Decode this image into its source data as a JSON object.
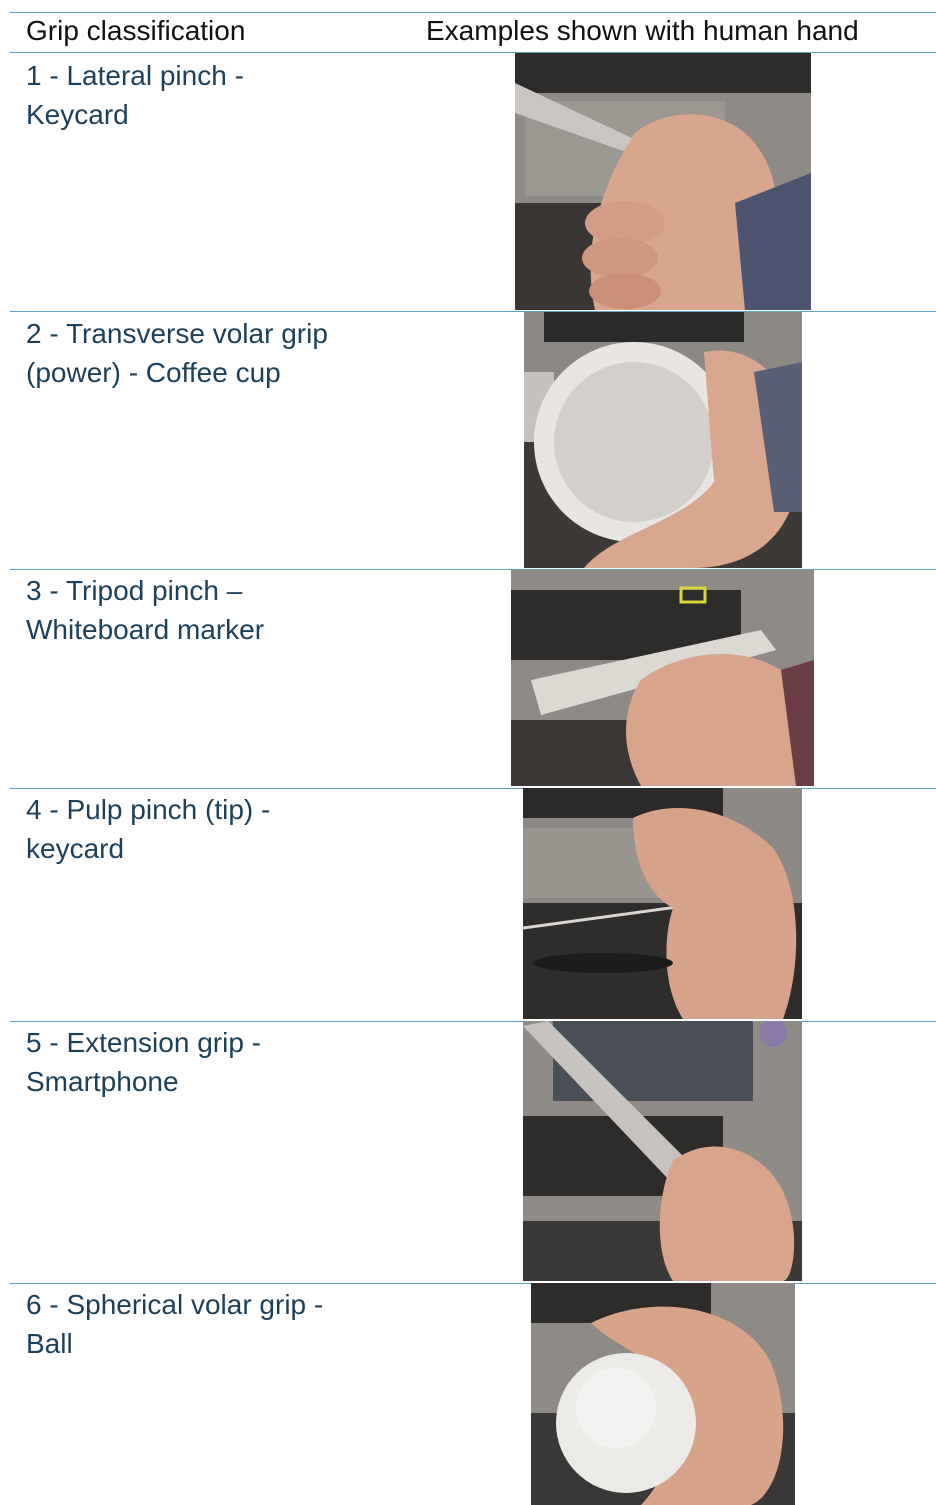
{
  "table": {
    "headers": [
      "Grip classification",
      "Examples shown with human hand"
    ],
    "rows": [
      {
        "label": "1 - Lateral pinch -\nKeycard"
      },
      {
        "label": "2 - Transverse volar grip\n(power) - Coffee cup"
      },
      {
        "label": "3 - Tripod pinch –\nWhiteboard marker"
      },
      {
        "label": "4 - Pulp pinch (tip) -\nkeycard"
      },
      {
        "label": "5 - Extension grip -\nSmartphone"
      },
      {
        "label": "6 - Spherical volar grip -\nBall"
      }
    ]
  },
  "colors": {
    "rule": "#5fa4c9",
    "label_text": "#1c3f5a",
    "header_text": "#111111"
  }
}
